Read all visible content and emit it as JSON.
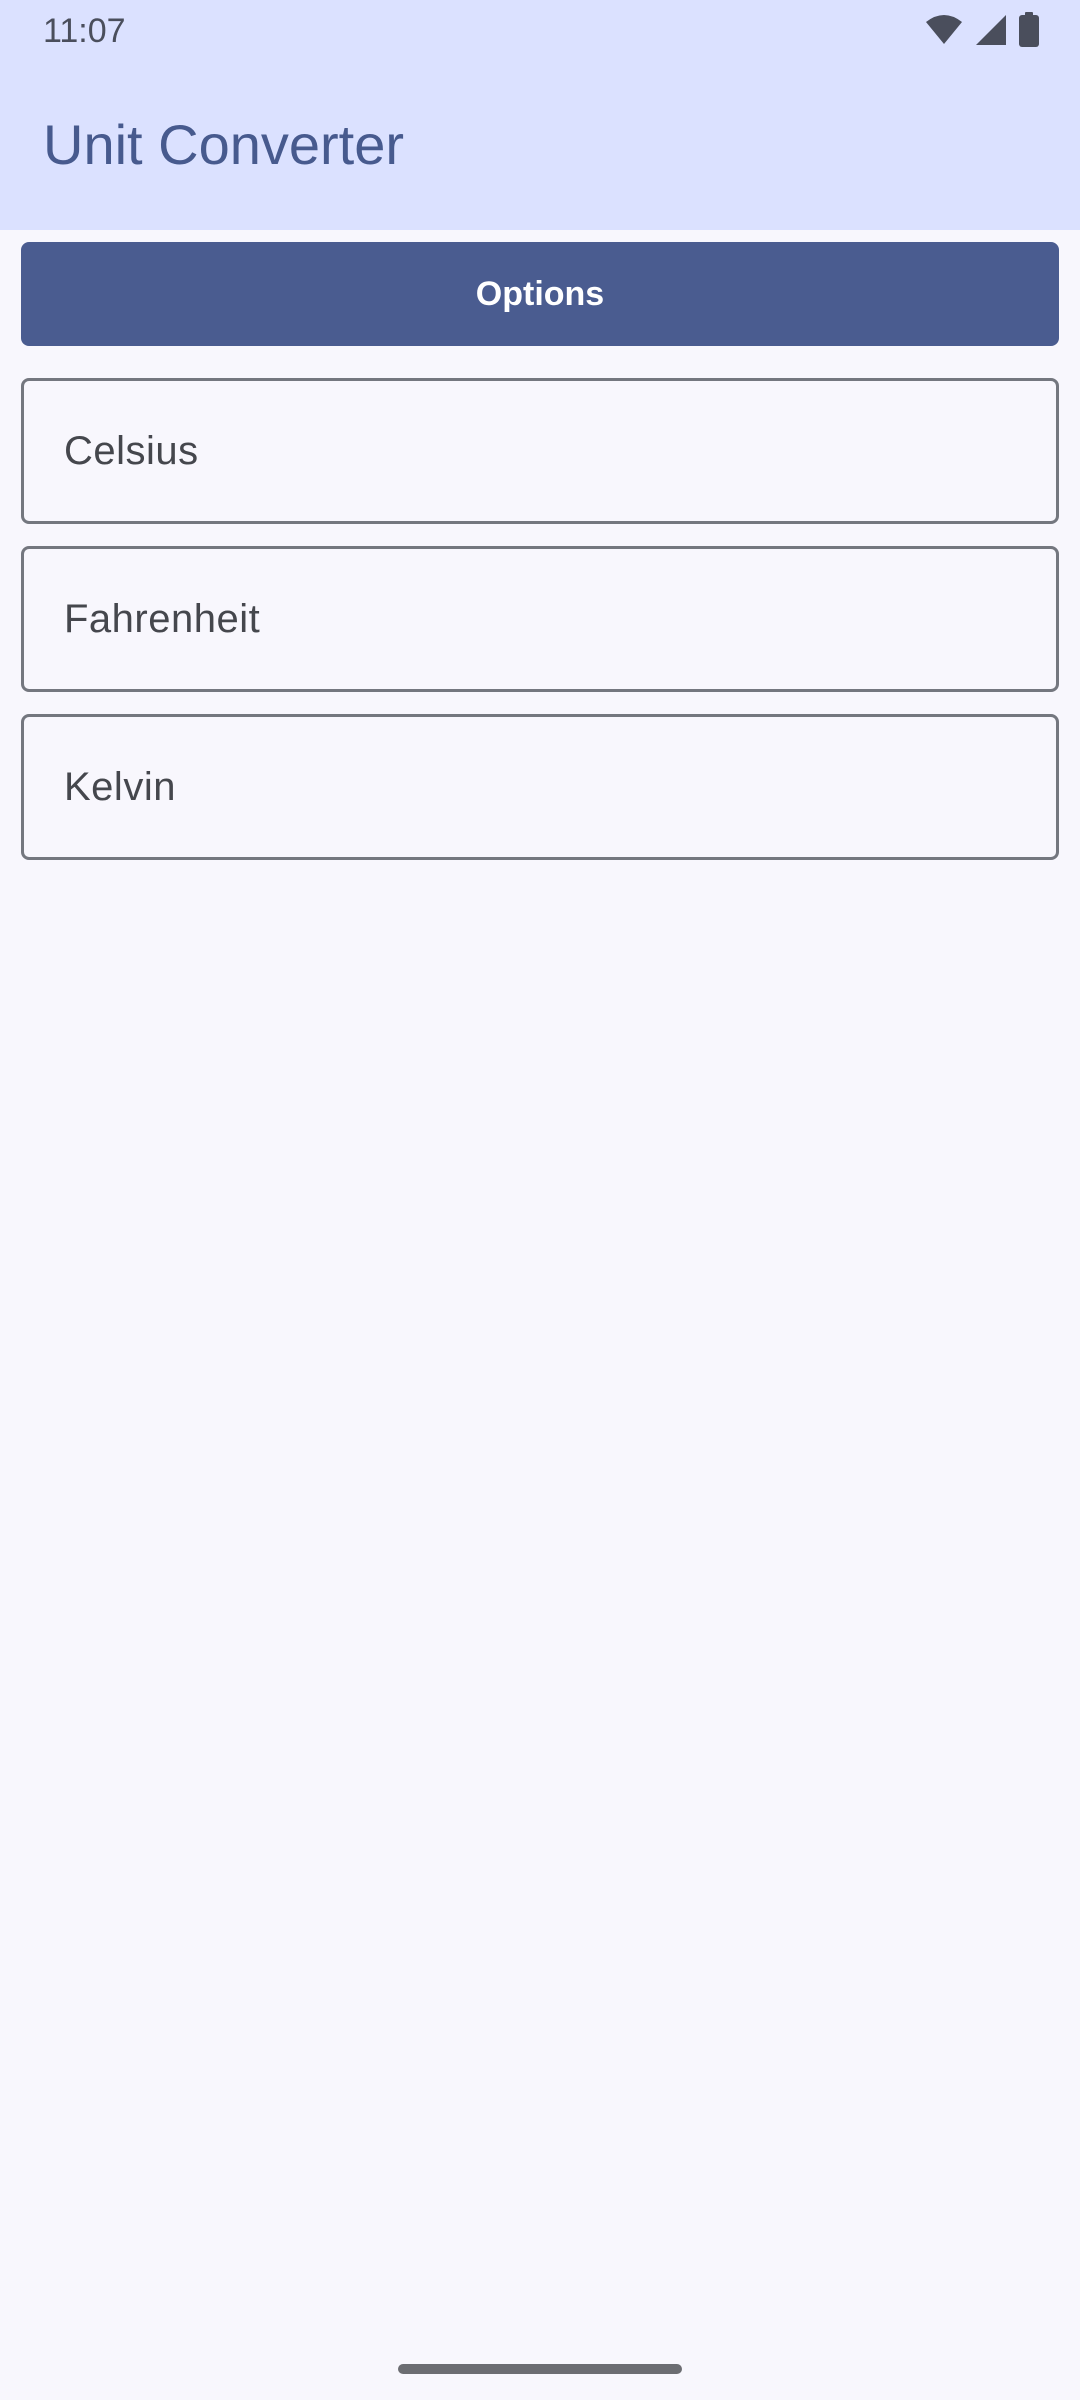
{
  "status_bar": {
    "time": "11:07",
    "icons": [
      "wifi-icon",
      "signal-icon",
      "battery-icon"
    ]
  },
  "app_bar": {
    "title": "Unit Converter"
  },
  "options_button": {
    "label": "Options"
  },
  "units": [
    {
      "label": "Celsius"
    },
    {
      "label": "Fahrenheit"
    },
    {
      "label": "Kelvin"
    }
  ],
  "colors": {
    "app_bar_bg": "#dbe1ff",
    "title": "#475a8e",
    "primary_button": "#4a5c90",
    "background": "#f8f7fd",
    "outline": "#74777f"
  }
}
